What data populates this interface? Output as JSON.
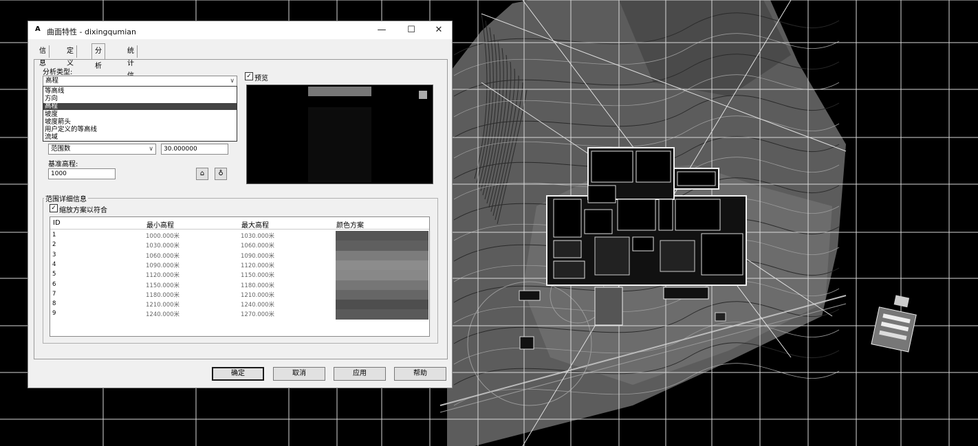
{
  "window": {
    "title": "曲面特性 - dixingqumian",
    "app_icon": "A",
    "minimize": "—",
    "maximize": "☐",
    "close": "✕"
  },
  "tabs": [
    {
      "label": "信息",
      "active": false
    },
    {
      "label": "定义",
      "active": false
    },
    {
      "label": "分析",
      "active": true
    },
    {
      "label": "统计信息",
      "active": false
    }
  ],
  "analysis": {
    "type_label": "分析类型:",
    "type_value": "高程",
    "dropdown_options": [
      "等高线",
      "方向",
      "高程",
      "坡度",
      "坡度箭头",
      "用户定义的等高线",
      "流域"
    ],
    "dropdown_selected_index": 2,
    "range_combo_value": "范围数",
    "range_field_value": "30.000000",
    "base_elev_label": "基准高程:",
    "base_elev_value": "1000"
  },
  "preview": {
    "label": "预览",
    "checked": true
  },
  "range_details": {
    "group_title": "范围详细信息",
    "stretch_label": "缩放方案以符合",
    "stretch_checked": true,
    "headers": [
      "ID",
      "最小高程",
      "最大高程",
      "颜色方案"
    ],
    "rows": [
      {
        "id": "1",
        "min": "1000.000米",
        "max": "1030.000米",
        "color": "#555555"
      },
      {
        "id": "2",
        "min": "1030.000米",
        "max": "1060.000米",
        "color": "#5f5f5f"
      },
      {
        "id": "3",
        "min": "1060.000米",
        "max": "1090.000米",
        "color": "#7c7c7c"
      },
      {
        "id": "4",
        "min": "1090.000米",
        "max": "1120.000米",
        "color": "#8c8c8c"
      },
      {
        "id": "5",
        "min": "1120.000米",
        "max": "1150.000米",
        "color": "#888888"
      },
      {
        "id": "6",
        "min": "1150.000米",
        "max": "1180.000米",
        "color": "#767676"
      },
      {
        "id": "7",
        "min": "1180.000米",
        "max": "1210.000米",
        "color": "#666666"
      },
      {
        "id": "8",
        "min": "1210.000米",
        "max": "1240.000米",
        "color": "#4e4e4e"
      },
      {
        "id": "9",
        "min": "1240.000米",
        "max": "1270.000米",
        "color": "#5a5a5a"
      }
    ]
  },
  "buttons": {
    "ok": "确定",
    "cancel": "取消",
    "apply": "应用",
    "help": "帮助"
  },
  "colors": {
    "canvas_bg": "#000000",
    "surface_fill": "#5c5c5c",
    "grid_line": "#d0d0d0",
    "dialog_bg": "#f0f0f0"
  }
}
